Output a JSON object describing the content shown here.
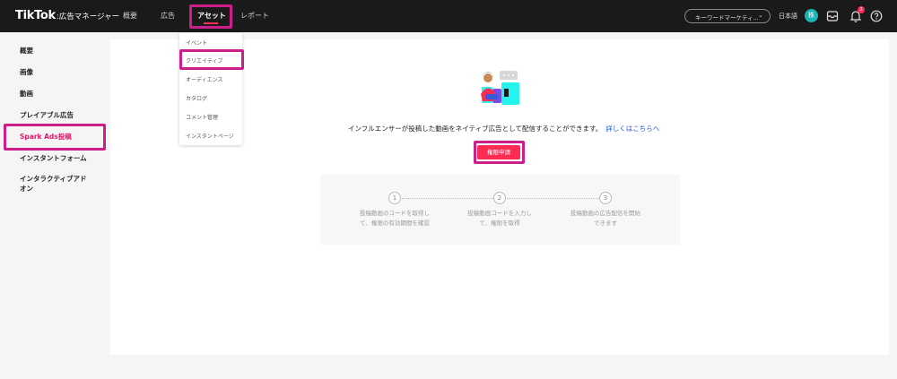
{
  "header": {
    "logo_brand": "TikTok",
    "logo_sub": ":広告マネージャー",
    "nav": [
      {
        "label": "概要"
      },
      {
        "label": "広告"
      },
      {
        "label": "アセット"
      },
      {
        "label": "レポート"
      }
    ],
    "account_select": "キーワードマーケティ...",
    "language": "日本語",
    "avatar_initial": "株",
    "notification_count": "2",
    "colors": {
      "bar": "#1a1a1a",
      "accent": "#fe2c55",
      "highlight": "#cc1f8a"
    }
  },
  "asset_menu": {
    "items": [
      {
        "label": "イベント"
      },
      {
        "label": "クリエイティブ"
      },
      {
        "label": "オーディエンス"
      },
      {
        "label": "カタログ"
      },
      {
        "label": "コメント管理"
      },
      {
        "label": "インスタントページ"
      }
    ]
  },
  "sidebar": {
    "items": [
      {
        "label": "概要"
      },
      {
        "label": "画像"
      },
      {
        "label": "動画"
      },
      {
        "label": "プレイアブル広告"
      },
      {
        "label": "Spark Ads投稿"
      },
      {
        "label": "インスタントフォーム"
      },
      {
        "label": "インタラクティブアド"
      },
      {
        "label": "オン"
      }
    ]
  },
  "main": {
    "headline": "インフルエンサーが投稿した動画をネイティブ広告として配信することができます。",
    "learn_more": "詳しくはこちらへ",
    "apply_button": "権限申請",
    "steps": [
      {
        "number": "1",
        "line1": "投稿動画のコードを取得し",
        "line2": "て、権限の有効期間を確認"
      },
      {
        "number": "2",
        "line1": "投稿動画コードを入力し",
        "line2": "て、権限を取得"
      },
      {
        "number": "3",
        "line1": "投稿動画の広告配信を開始",
        "line2": "できます"
      }
    ]
  }
}
